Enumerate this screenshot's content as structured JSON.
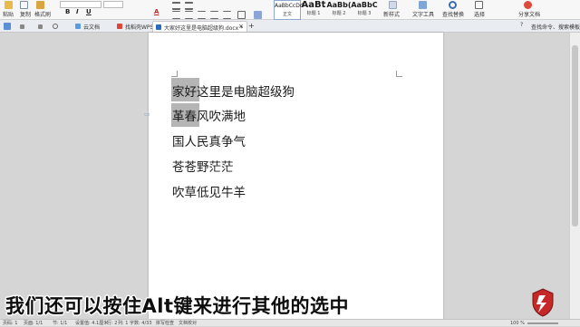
{
  "ribbon": {
    "paste": "粘贴",
    "copy": "复制",
    "format_painter": "格式刷",
    "bold": "B",
    "italic": "I",
    "underline": "U",
    "font_color": "A",
    "styles": [
      {
        "sample": "AaBbCcDd",
        "label": "正文"
      },
      {
        "sample": "AaBt",
        "label": "标题 1"
      },
      {
        "sample": "AaBb(",
        "label": "标题 2"
      },
      {
        "sample": "AaBbC",
        "label": "标题 3"
      }
    ],
    "new_style": "新样式",
    "text_tools": "文字工具",
    "find_replace": "查找替换",
    "select": "选择",
    "share_doc": "分享文档",
    "search_hint": "查找命令、搜索模板"
  },
  "tabs": [
    {
      "label": "云文档"
    },
    {
      "label": "找稻壳WPS"
    },
    {
      "label": "大家好这里是电脑超级狗.docx *"
    }
  ],
  "document": {
    "lines": [
      "家好这里是电脑超级狗",
      "革春风吹满地",
      "国人民真争气",
      "苍苍野茫茫",
      "吹草低见牛羊"
    ]
  },
  "caption": "我们还可以按住Alt键来进行其他的选中",
  "status": {
    "page_no": "页码: 1",
    "page": "页面: 1/1",
    "section": "节: 1/1",
    "setting": "设置值: 4.1厘米",
    "row": "行: 2",
    "col": "列: 1",
    "words": "字数: 4/33",
    "spell": "拼写检查",
    "proof": "文档校对",
    "zoom": "100 %"
  },
  "colors": {
    "accent": "#2a6cc0",
    "selection": "#b5b5b5",
    "page": "#ffffff",
    "canvas": "#d5d5d5"
  }
}
